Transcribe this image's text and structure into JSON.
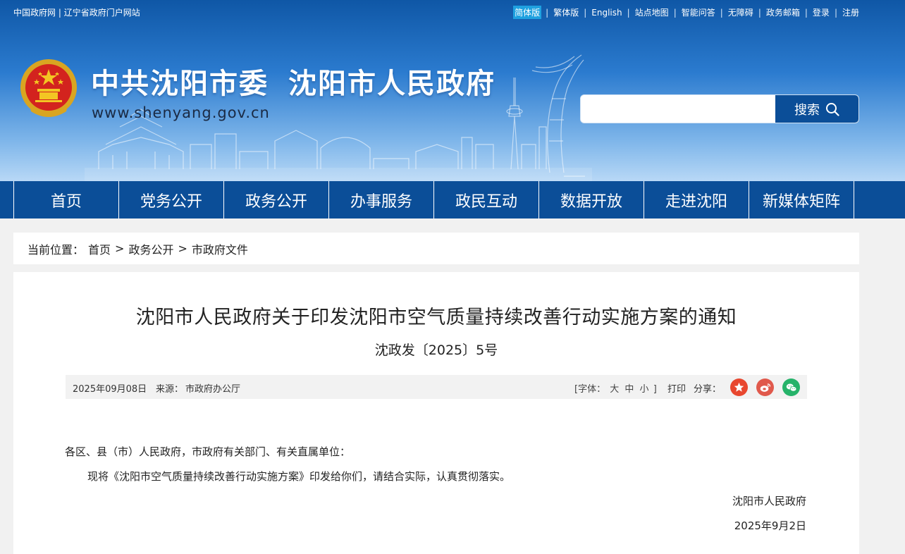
{
  "topbar": {
    "left_links": [
      "中国政府网",
      "辽宁省政府门户网站"
    ],
    "left_sep": "|",
    "right_links": [
      "简体版",
      "繁体版",
      "English",
      "站点地图",
      "智能问答",
      "无障碍",
      "政务邮箱",
      "登录",
      "注册"
    ],
    "right_sep": "|"
  },
  "header": {
    "title_part1": "中共沈阳市委",
    "title_part2": "沈阳市人民政府",
    "url": "www.shenyang.gov.cn",
    "search_placeholder": "",
    "search_button": "搜索"
  },
  "nav": {
    "items": [
      "首页",
      "党务公开",
      "政务公开",
      "办事服务",
      "政民互动",
      "数据开放",
      "走进沈阳",
      "新媒体矩阵"
    ]
  },
  "breadcrumb": {
    "label": "当前位置：",
    "items": [
      "首页",
      "政务公开",
      "市政府文件"
    ],
    "arrow": ">"
  },
  "article": {
    "title": "沈阳市人民政府关于印发沈阳市空气质量持续改善行动实施方案的通知",
    "doc_number": "沈政发〔2025〕5号",
    "meta": {
      "date": "2025年09月08日",
      "source_label": "来源：",
      "source": "市政府办公厅",
      "font_label": "[字体：",
      "font_sizes": [
        "大",
        "中",
        "小"
      ],
      "font_close": "]",
      "print": "打印",
      "share_label": "分享："
    },
    "salutation": "各区、县（市）人民政府，市政府有关部门、有关直属单位：",
    "paragraph": "现将《沈阳市空气质量持续改善行动实施方案》印发给你们，请结合实际，认真贯彻落实。",
    "signature": "沈阳市人民政府",
    "sign_date": "2025年9月2日"
  },
  "icons": {
    "share_1": "party-share-icon",
    "share_2": "weibo-icon",
    "share_3": "wechat-icon",
    "search": "search-icon"
  },
  "colors": {
    "nav_bg": "#0b4e98",
    "active_lang_bg": "#1fa1e0",
    "share_1": "#e8472f",
    "share_2": "#e0594c",
    "share_3": "#26b36a"
  }
}
